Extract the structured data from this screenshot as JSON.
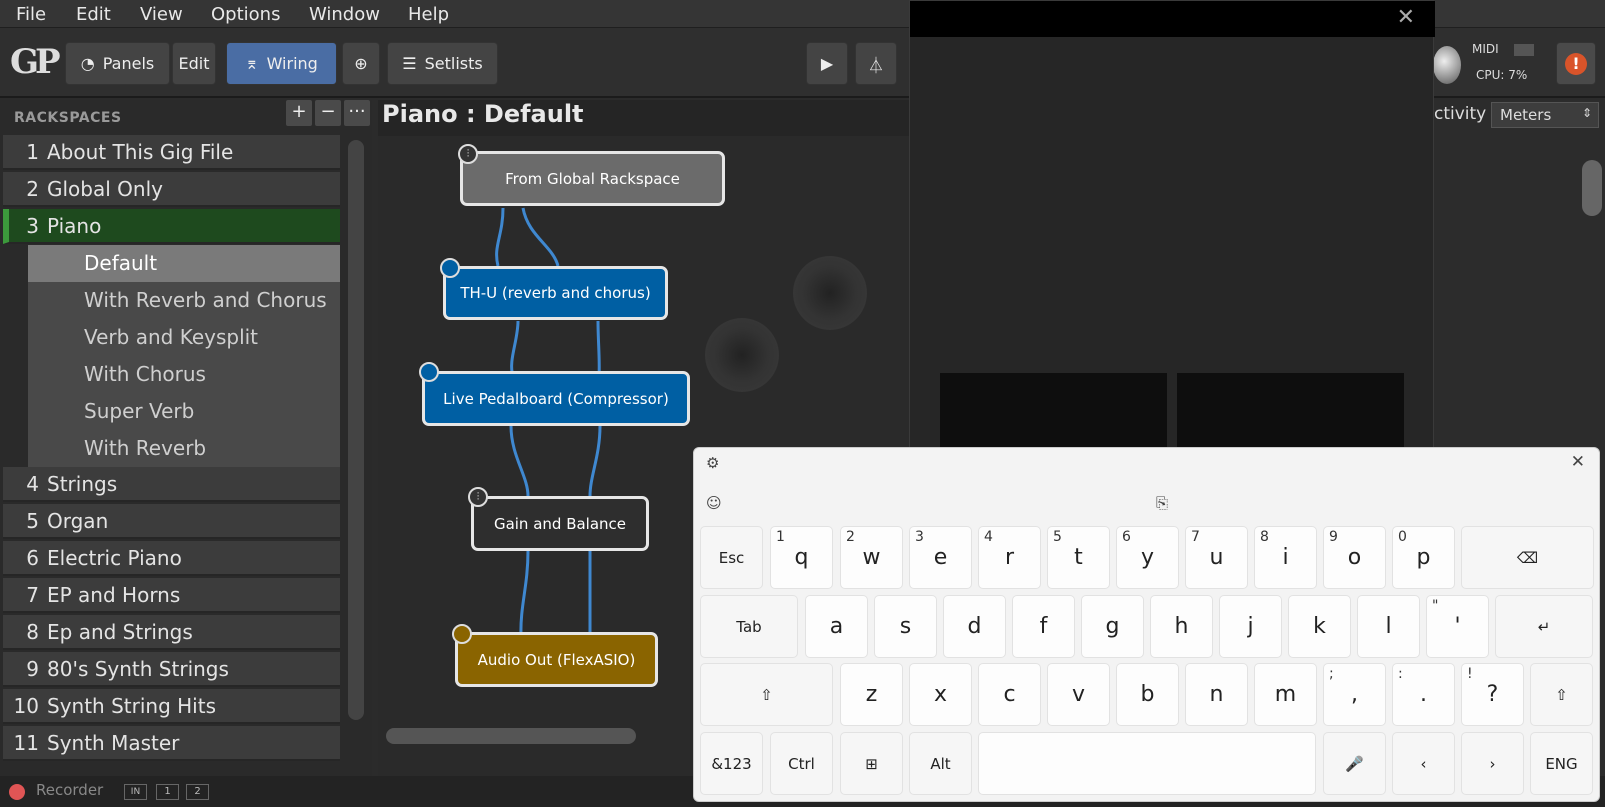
{
  "menu": [
    "File",
    "Edit",
    "View",
    "Options",
    "Window",
    "Help"
  ],
  "toolbar": {
    "panels": "Panels",
    "edit": "Edit",
    "wiring": "Wiring",
    "setlists": "Setlists",
    "midi": "MIDI",
    "cpu": "CPU:  7%"
  },
  "rackspaces": {
    "header": "RACKSPACES",
    "add": "+",
    "remove": "−",
    "more": "···",
    "items": [
      {
        "num": "1",
        "name": "About This Gig File"
      },
      {
        "num": "2",
        "name": "Global Only"
      },
      {
        "num": "3",
        "name": "Piano"
      },
      {
        "num": "4",
        "name": "Strings"
      },
      {
        "num": "5",
        "name": "Organ"
      },
      {
        "num": "6",
        "name": "Electric Piano"
      },
      {
        "num": "7",
        "name": "EP and Horns"
      },
      {
        "num": "8",
        "name": "Ep and Strings"
      },
      {
        "num": "9",
        "name": "80's Synth Strings"
      },
      {
        "num": "10",
        "name": "Synth String Hits"
      },
      {
        "num": "11",
        "name": "Synth Master"
      }
    ],
    "variations": [
      "Default",
      "With Reverb and Chorus",
      "Verb and Keysplit",
      "With Chorus",
      "Super Verb",
      "With Reverb"
    ]
  },
  "recorder": {
    "label": "Recorder",
    "in": "IN",
    "t1": "1",
    "t2": "2"
  },
  "main": {
    "title": "Piano : Default",
    "activity": "ctivity",
    "meters": "Meters"
  },
  "nodes": {
    "global": "From Global Rackspace",
    "thu": "TH-U (reverb and chorus)",
    "pedal": "Live Pedalboard (Compressor)",
    "gain": "Gain and Balance",
    "audio": "Audio Out (FlexASIO)"
  },
  "colors": {
    "blue": "#005fa3",
    "gold": "#8a6400",
    "gray": "#6b6b6b",
    "dark": "#2e2e2e",
    "green": "#1e4a1e"
  },
  "keyboard": {
    "row1": [
      {
        "k": "Esc"
      },
      {
        "k": "q",
        "h": "1"
      },
      {
        "k": "w",
        "h": "2"
      },
      {
        "k": "e",
        "h": "3"
      },
      {
        "k": "r",
        "h": "4"
      },
      {
        "k": "t",
        "h": "5"
      },
      {
        "k": "y",
        "h": "6"
      },
      {
        "k": "u",
        "h": "7"
      },
      {
        "k": "i",
        "h": "8"
      },
      {
        "k": "o",
        "h": "9"
      },
      {
        "k": "p",
        "h": "0"
      },
      {
        "k": "⌫"
      }
    ],
    "row2": [
      {
        "k": "Tab"
      },
      {
        "k": "a"
      },
      {
        "k": "s"
      },
      {
        "k": "d"
      },
      {
        "k": "f"
      },
      {
        "k": "g"
      },
      {
        "k": "h"
      },
      {
        "k": "j"
      },
      {
        "k": "k"
      },
      {
        "k": "l"
      },
      {
        "k": "'",
        "h": "\""
      },
      {
        "k": "↵"
      }
    ],
    "row3": [
      {
        "k": "⇧"
      },
      {
        "k": "z"
      },
      {
        "k": "x"
      },
      {
        "k": "c"
      },
      {
        "k": "v"
      },
      {
        "k": "b"
      },
      {
        "k": "n"
      },
      {
        "k": "m"
      },
      {
        "k": ",",
        "h": ";"
      },
      {
        "k": ".",
        "h": ":"
      },
      {
        "k": "?",
        "h": "!"
      },
      {
        "k": "⇧"
      }
    ],
    "row4": [
      {
        "k": "&123"
      },
      {
        "k": "Ctrl"
      },
      {
        "k": "⊞"
      },
      {
        "k": "Alt"
      },
      {
        "k": ""
      },
      {
        "k": "🎤"
      },
      {
        "k": "‹"
      },
      {
        "k": "›"
      },
      {
        "k": "ENG"
      }
    ]
  }
}
